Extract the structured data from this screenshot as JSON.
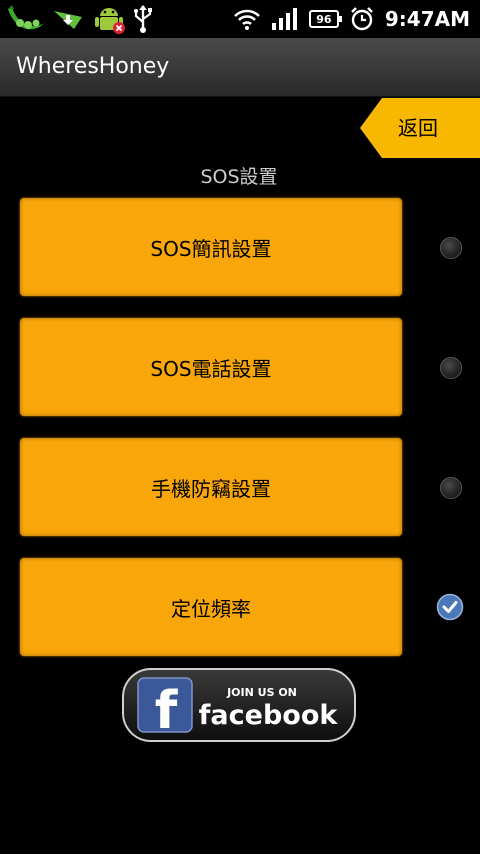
{
  "status_bar": {
    "time": "9:47AM",
    "battery": "96",
    "icons": [
      "peapod-icon",
      "download-icon",
      "android-debug-icon",
      "usb-icon",
      "wifi-icon",
      "signal-icon",
      "battery-icon",
      "alarm-icon"
    ]
  },
  "app": {
    "title": "WheresHoney"
  },
  "back_button": {
    "label": "返回"
  },
  "section": {
    "title": "SOS設置"
  },
  "menu": [
    {
      "label": "SOS簡訊設置",
      "selected": false
    },
    {
      "label": "SOS電話設置",
      "selected": false
    },
    {
      "label": "手機防竊設置",
      "selected": false
    },
    {
      "label": "定位頻率",
      "selected": true
    }
  ],
  "facebook": {
    "join_text": "JOIN US ON",
    "brand_text": "facebook",
    "logo_letter": "f"
  },
  "colors": {
    "accent": "#f8a60a",
    "back_tab": "#f8b800",
    "facebook_blue": "#3b5998",
    "check_blue": "#4a78b8"
  }
}
